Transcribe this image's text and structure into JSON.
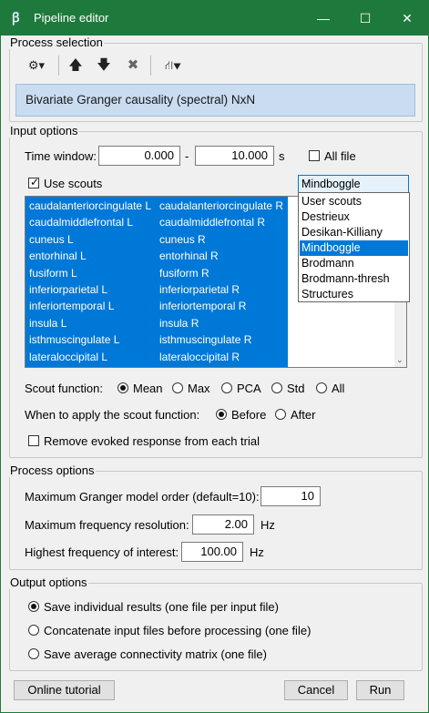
{
  "window": {
    "title": "Pipeline editor",
    "app_icon": "brainstorm-icon",
    "controls": {
      "minimize": "—",
      "maximize": "☐",
      "close": "✕"
    }
  },
  "process_selection": {
    "group_title": "Process selection",
    "toolbar": [
      {
        "name": "gear-menu-icon",
        "glyph": "⚙▾"
      },
      {
        "name": "move-up-icon",
        "glyph": "🡅"
      },
      {
        "name": "move-down-icon",
        "glyph": "🡇"
      },
      {
        "name": "delete-icon",
        "glyph": "✖"
      },
      {
        "name": "pipeline-tree-icon",
        "glyph": "⛙▾"
      }
    ],
    "selected_process": "Bivariate Granger causality (spectral) NxN"
  },
  "input_options": {
    "group_title": "Input options",
    "time_window_label": "Time window:",
    "time_start": "0.000",
    "time_dash": "-",
    "time_end": "10.000",
    "time_unit": "s",
    "all_file_label": "All file",
    "all_file_checked": false,
    "use_scouts_label": "Use scouts",
    "use_scouts_checked": true,
    "atlas_selected": "Mindboggle",
    "atlas_options": [
      "User scouts",
      "Destrieux",
      "Desikan-Killiany",
      "Mindboggle",
      "Brodmann",
      "Brodmann-thresh",
      "Structures"
    ],
    "scouts_col1": [
      "caudalanteriorcingulate L",
      "caudalmiddlefrontal L",
      "cuneus L",
      "entorhinal L",
      "fusiform L",
      "inferiorparietal L",
      "inferiortemporal L",
      "insula L",
      "isthmuscingulate L",
      "lateraloccipital L"
    ],
    "scouts_col2": [
      "caudalanteriorcingulate R",
      "caudalmiddlefrontal R",
      "cuneus R",
      "entorhinal R",
      "fusiform R",
      "inferiorparietal R",
      "inferiortemporal R",
      "insula R",
      "isthmuscingulate R",
      "lateraloccipital R"
    ],
    "scout_function_label": "Scout function:",
    "scout_function_options": [
      "Mean",
      "Max",
      "PCA",
      "Std",
      "All"
    ],
    "scout_function_selected": "Mean",
    "when_apply_label": "When to apply the scout function:",
    "when_apply_options": [
      "Before",
      "After"
    ],
    "when_apply_selected": "Before",
    "remove_evoked_label": "Remove evoked response from each trial",
    "remove_evoked_checked": false
  },
  "process_options": {
    "group_title": "Process options",
    "model_order_label": "Maximum Granger model order (default=10):",
    "model_order_value": "10",
    "freq_res_label": "Maximum frequency resolution:",
    "freq_res_value": "2.00",
    "freq_res_unit": "Hz",
    "highest_freq_label": "Highest frequency of interest:",
    "highest_freq_value": "100.00",
    "highest_freq_unit": "Hz"
  },
  "output_options": {
    "group_title": "Output options",
    "options": [
      "Save individual results (one file per input file)",
      "Concatenate input files before processing (one file)",
      "Save average connectivity matrix (one file)"
    ],
    "selected": "Save individual results (one file per input file)"
  },
  "footer": {
    "tutorial_label": "Online tutorial",
    "cancel_label": "Cancel",
    "run_label": "Run"
  }
}
